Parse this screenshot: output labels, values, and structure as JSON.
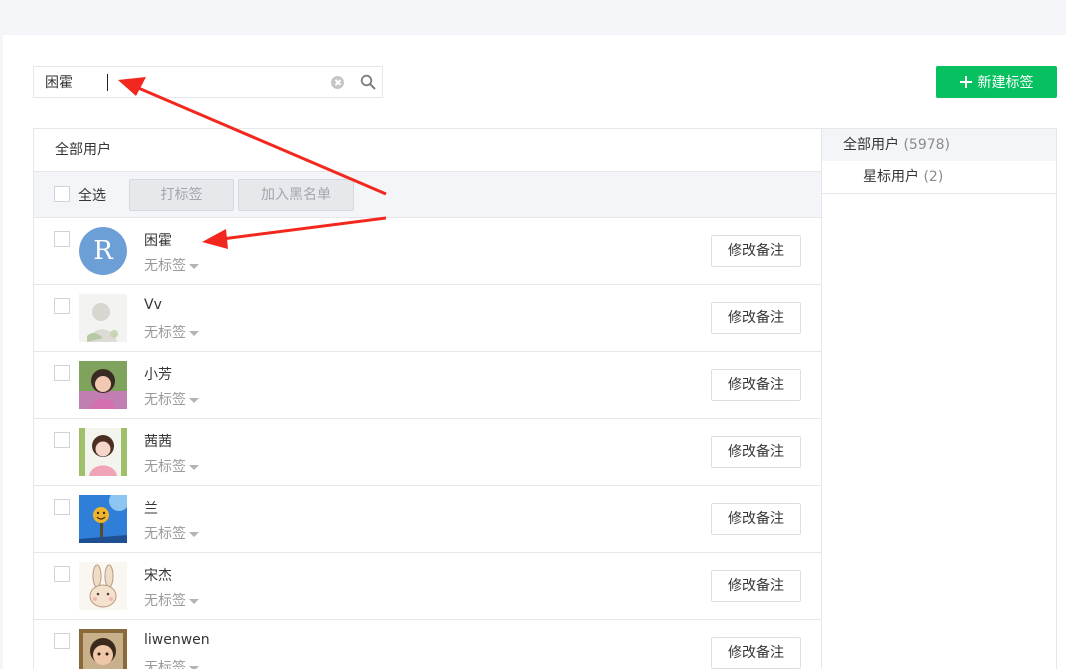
{
  "search": {
    "value": "困霍",
    "placeholder": ""
  },
  "new_tag_button": {
    "label": "新建标签"
  },
  "table": {
    "header": "全部用户",
    "toolbar": {
      "select_all": "全选",
      "tag_button": "打标签",
      "blacklist_button": "加入黑名单"
    },
    "rows": [
      {
        "name": "困霍",
        "tag": "无标签",
        "remark_button": "修改备注",
        "avatar_letter": "R"
      },
      {
        "name": "Vv",
        "tag": "无标签",
        "remark_button": "修改备注"
      },
      {
        "name": "小芳",
        "tag": "无标签",
        "remark_button": "修改备注"
      },
      {
        "name": "茜茜",
        "tag": "无标签",
        "remark_button": "修改备注"
      },
      {
        "name": "兰",
        "tag": "无标签",
        "remark_button": "修改备注"
      },
      {
        "name": "宋杰",
        "tag": "无标签",
        "remark_button": "修改备注"
      },
      {
        "name": "liwenwen",
        "tag": "无标签",
        "remark_button": "修改备注"
      }
    ]
  },
  "side": {
    "all_users": {
      "label": "全部用户",
      "count": "(5978)"
    },
    "starred_users": {
      "label": "星标用户",
      "count": "(2)"
    }
  },
  "colors": {
    "accent_green": "#07c160",
    "annotation_red": "#f2281f",
    "avatar_blue": "#6c9fd6"
  }
}
